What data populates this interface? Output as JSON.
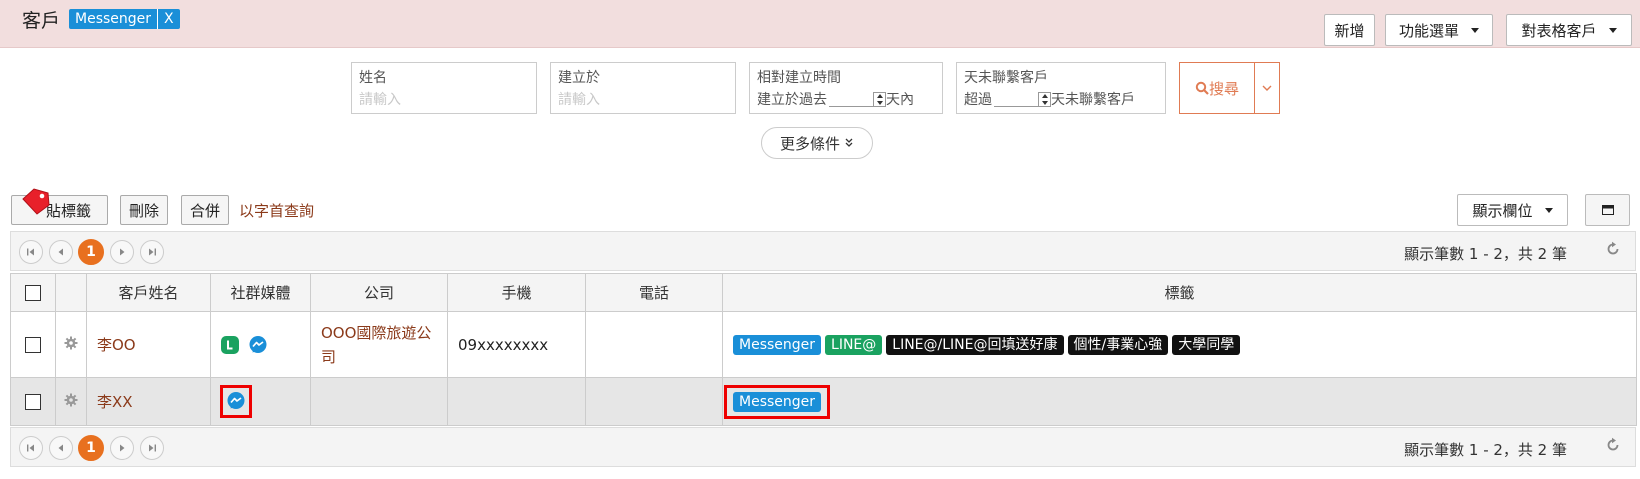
{
  "header": {
    "title": "客戶",
    "filter_tag": "Messenger",
    "filter_tag_close": "X",
    "buttons": {
      "add": "新增",
      "function_menu": "功能選單",
      "table_customers": "對表格客戶"
    }
  },
  "search": {
    "name": {
      "label": "姓名",
      "placeholder": "請輸入"
    },
    "created_at": {
      "label": "建立於",
      "placeholder": "請輸入"
    },
    "relative_created": {
      "label": "相對建立時間",
      "prefix": "建立於過去",
      "suffix": "天內"
    },
    "no_contact": {
      "label": "天未聯繫客戶",
      "prefix": "超過",
      "suffix": "天未聯繫客戶"
    },
    "search_button": "搜尋",
    "more_conditions": "更多條件"
  },
  "toolbar": {
    "tag_button": "貼標籤",
    "delete_button": "刪除",
    "merge_button": "合併",
    "initial_search_link": "以字首查詢",
    "display_columns": "顯示欄位"
  },
  "pager": {
    "current_page": "1",
    "info": "顯示筆數 1 - 2，共 2 筆"
  },
  "table": {
    "columns": [
      "客戶姓名",
      "社群媒體",
      "公司",
      "手機",
      "電話",
      "標籤"
    ],
    "rows": [
      {
        "name": "李OO",
        "social": [
          "line-icon",
          "messenger-icon"
        ],
        "company": "OOO國際旅遊公司",
        "mobile": "09xxxxxxxx",
        "phone": "",
        "tags": [
          {
            "label": "Messenger",
            "color": "#1a8fd8"
          },
          {
            "label": "LINE@",
            "color": "#1aa260"
          },
          {
            "label": "LINE@/LINE@回填送好康",
            "color": "#111111"
          },
          {
            "label": "個性/事業心強",
            "color": "#111111"
          },
          {
            "label": "大學同學",
            "color": "#111111"
          }
        ]
      },
      {
        "name": "李XX",
        "social": [
          "messenger-icon"
        ],
        "company": "",
        "mobile": "",
        "phone": "",
        "tags": [
          {
            "label": "Messenger",
            "color": "#1a8fd8"
          }
        ]
      }
    ]
  },
  "colors": {
    "accent": "#e8701f",
    "messenger": "#1a8fd8",
    "line": "#1aa260",
    "highlight": "#e00000"
  }
}
